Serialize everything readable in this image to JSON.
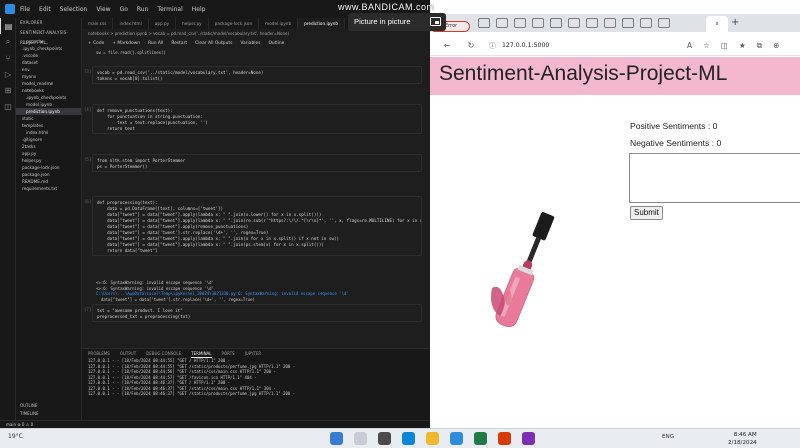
{
  "overlay": {
    "watermark": "www.BANDICAM.com",
    "pip_label": "Picture in picture"
  },
  "vscode": {
    "menu": [
      "File",
      "Edit",
      "Selection",
      "View",
      "Go",
      "Run",
      "Terminal",
      "Help"
    ],
    "explorer_title": "EXPLORER",
    "explorer_root": "SENTIMENT-ANALYSIS-PROJECT-ML",
    "tree": [
      {
        "label": "__pycache__",
        "indent": false,
        "selected": false
      },
      {
        "label": ".ipynb_checkpoints",
        "indent": false,
        "selected": false
      },
      {
        "label": ".vscode",
        "indent": false,
        "selected": false
      },
      {
        "label": "dataset",
        "indent": false,
        "selected": false
      },
      {
        "label": "env",
        "indent": false,
        "selected": false
      },
      {
        "label": "myenv",
        "indent": false,
        "selected": false
      },
      {
        "label": "model_readme",
        "indent": false,
        "selected": false
      },
      {
        "label": "notebooks",
        "indent": false,
        "selected": false
      },
      {
        "label": ".ipynb_checkpoints",
        "indent": true,
        "selected": false
      },
      {
        "label": "model.ipynb",
        "indent": true,
        "selected": false
      },
      {
        "label": "prediction.ipynb",
        "indent": true,
        "selected": true
      },
      {
        "label": "static",
        "indent": false,
        "selected": false
      },
      {
        "label": "templates",
        "indent": false,
        "selected": false
      },
      {
        "label": "index.html",
        "indent": true,
        "selected": false
      },
      {
        "label": ".gitignore",
        "indent": false,
        "selected": false
      },
      {
        "label": "2tasks",
        "indent": false,
        "selected": false
      },
      {
        "label": "app.py",
        "indent": false,
        "selected": false
      },
      {
        "label": "helper.py",
        "indent": false,
        "selected": false
      },
      {
        "label": "package-lock.json",
        "indent": false,
        "selected": false
      },
      {
        "label": "package.json",
        "indent": false,
        "selected": false
      },
      {
        "label": "README.md",
        "indent": false,
        "selected": false
      },
      {
        "label": "requirements.txt",
        "indent": false,
        "selected": false
      }
    ],
    "explorer_footer": [
      "OUTLINE",
      "TIMELINE"
    ],
    "tabs": [
      {
        "label": "main.css",
        "active": false
      },
      {
        "label": "index.html",
        "active": false
      },
      {
        "label": "app.py",
        "active": false
      },
      {
        "label": "helper.py",
        "active": false
      },
      {
        "label": "package-lock.json",
        "active": false
      },
      {
        "label": "model.ipynb",
        "active": false
      },
      {
        "label": "prediction.ipynb",
        "active": true
      }
    ],
    "breadcrumb": "notebooks > prediction.ipynb > vocab = pd.read_csv('../static/model/vocabulary.txt', header=None)",
    "nb_toolbar": [
      "+ Code",
      "+ Markdown",
      "Run All",
      "Restart",
      "Clear All Outputs",
      "Variables",
      "Outline"
    ],
    "top_code_line": "sw = file.read().splitlines()",
    "cells": [
      {
        "exec": "[3]",
        "lines": [
          "vocab = pd.read_csv('../static/model/vocabulary.txt', header=None)",
          "tokens = vocab[0].tolist()"
        ]
      },
      {
        "exec": "[4]",
        "lines": [
          "def remove_punctuations(text):",
          "    for punctuation in string.punctuation:",
          "        text = text.replace(punctuation, '')",
          "    return text"
        ]
      },
      {
        "exec": "[5]",
        "lines": [
          "from nltk.stem import PorterStemmer",
          "ps = PorterStemmer()"
        ]
      },
      {
        "exec": "[6]",
        "lines": [
          "def preprocessing(text):",
          "    data = pd.DataFrame([text], columns=['tweet'])",
          "    data[\"tweet\"] = data[\"tweet\"].apply(lambda x: \" \".join(x.lower() for x in x.split()))",
          "    data[\"tweet\"] = data[\"tweet\"].apply(lambda x: \" \".join(re.sub(r'^https?:\\/\\/.*[\\r\\n]*', '', x, flags=re.MULTILINE) for x in x.split()))",
          "    data[\"tweet\"] = data[\"tweet\"].apply(remove_punctuations)",
          "    data[\"tweet\"] = data['tweet'].str.replace('\\d+', '', regex=True)",
          "    data[\"tweet\"] = data[\"tweet\"].apply(lambda x: \" \".join(x for x in x.split() if x not in sw))",
          "    data[\"tweet\"] = data[\"tweet\"].apply(lambda x: \" \".join(ps.stem(x) for x in x.split()))",
          "    return data[\"tweet\"]"
        ]
      },
      {
        "exec": "[7]",
        "lines": [
          "txt = \"awesome product. I love it\"",
          "preprocessed_txt = preprocessing(txt)"
        ]
      }
    ],
    "warning_lines": [
      "<>:6: SyntaxWarning: invalid escape sequence '\\d'",
      "<>:6: SyntaxWarning: invalid escape sequence '\\d'",
      "C:\\Users\\...\\AppData\\Local\\Temp\\ipykernel_20024\\3021330.py:6: SyntaxWarning: invalid escape sequence '\\d'",
      "  data[\"tweet\"] = data['tweet'].str.replace('\\d+', '', regex=True)"
    ],
    "panel_tabs": [
      "PROBLEMS",
      "OUTPUT",
      "DEBUG CONSOLE",
      "TERMINAL",
      "PORTS",
      "JUPYTER"
    ],
    "terminal_lines": [
      "127.0.0.1 - - [18/Feb/2024 08:44:55] \"GET / HTTP/1.1\" 200 -",
      "127.0.0.1 - - [18/Feb/2024 08:44:55] \"GET /static/products/perfume.jpg HTTP/1.1\" 200 -",
      "127.0.0.1 - - [18/Feb/2024 08:44:56] \"GET /static/css/main.css HTTP/1.1\" 200 -",
      "127.0.0.1 - - [18/Feb/2024 08:44:57] \"GET /favicon.ico HTTP/1.1\" 404 -",
      "127.0.0.1 - - [18/Feb/2024 08:46:37] \"GET / HTTP/1.1\" 200 -",
      "127.0.0.1 - - [18/Feb/2024 08:46:37] \"GET /static/css/main.css HTTP/1.1\" 304 -",
      "127.0.0.1 - - [18/Feb/2024 08:46:37] \"GET /static/products/perfume.jpg HTTP/1.1\" 200 -"
    ],
    "status": "main  ⊗ 0 ⚠ 0"
  },
  "browser": {
    "error_chip": "Error",
    "active_tab_label": "x",
    "url": "127.0.0.1:5000",
    "page": {
      "title": "Sentiment-Analysis-Project-ML",
      "positive_label": "Positive Sentiments : 0",
      "negative_label": "Negative Sentiments : 0",
      "review_value": "",
      "submit_label": "Submit"
    },
    "colors": {
      "header_bg": "#f3b8ce",
      "lipgloss_cap": "#1c1c1c",
      "lipgloss_bottle": "#e87a9a"
    }
  },
  "taskbar": {
    "weather": "19°C",
    "tray_lang": "ENG",
    "time": "8:46 AM",
    "date": "2/18/2024"
  }
}
